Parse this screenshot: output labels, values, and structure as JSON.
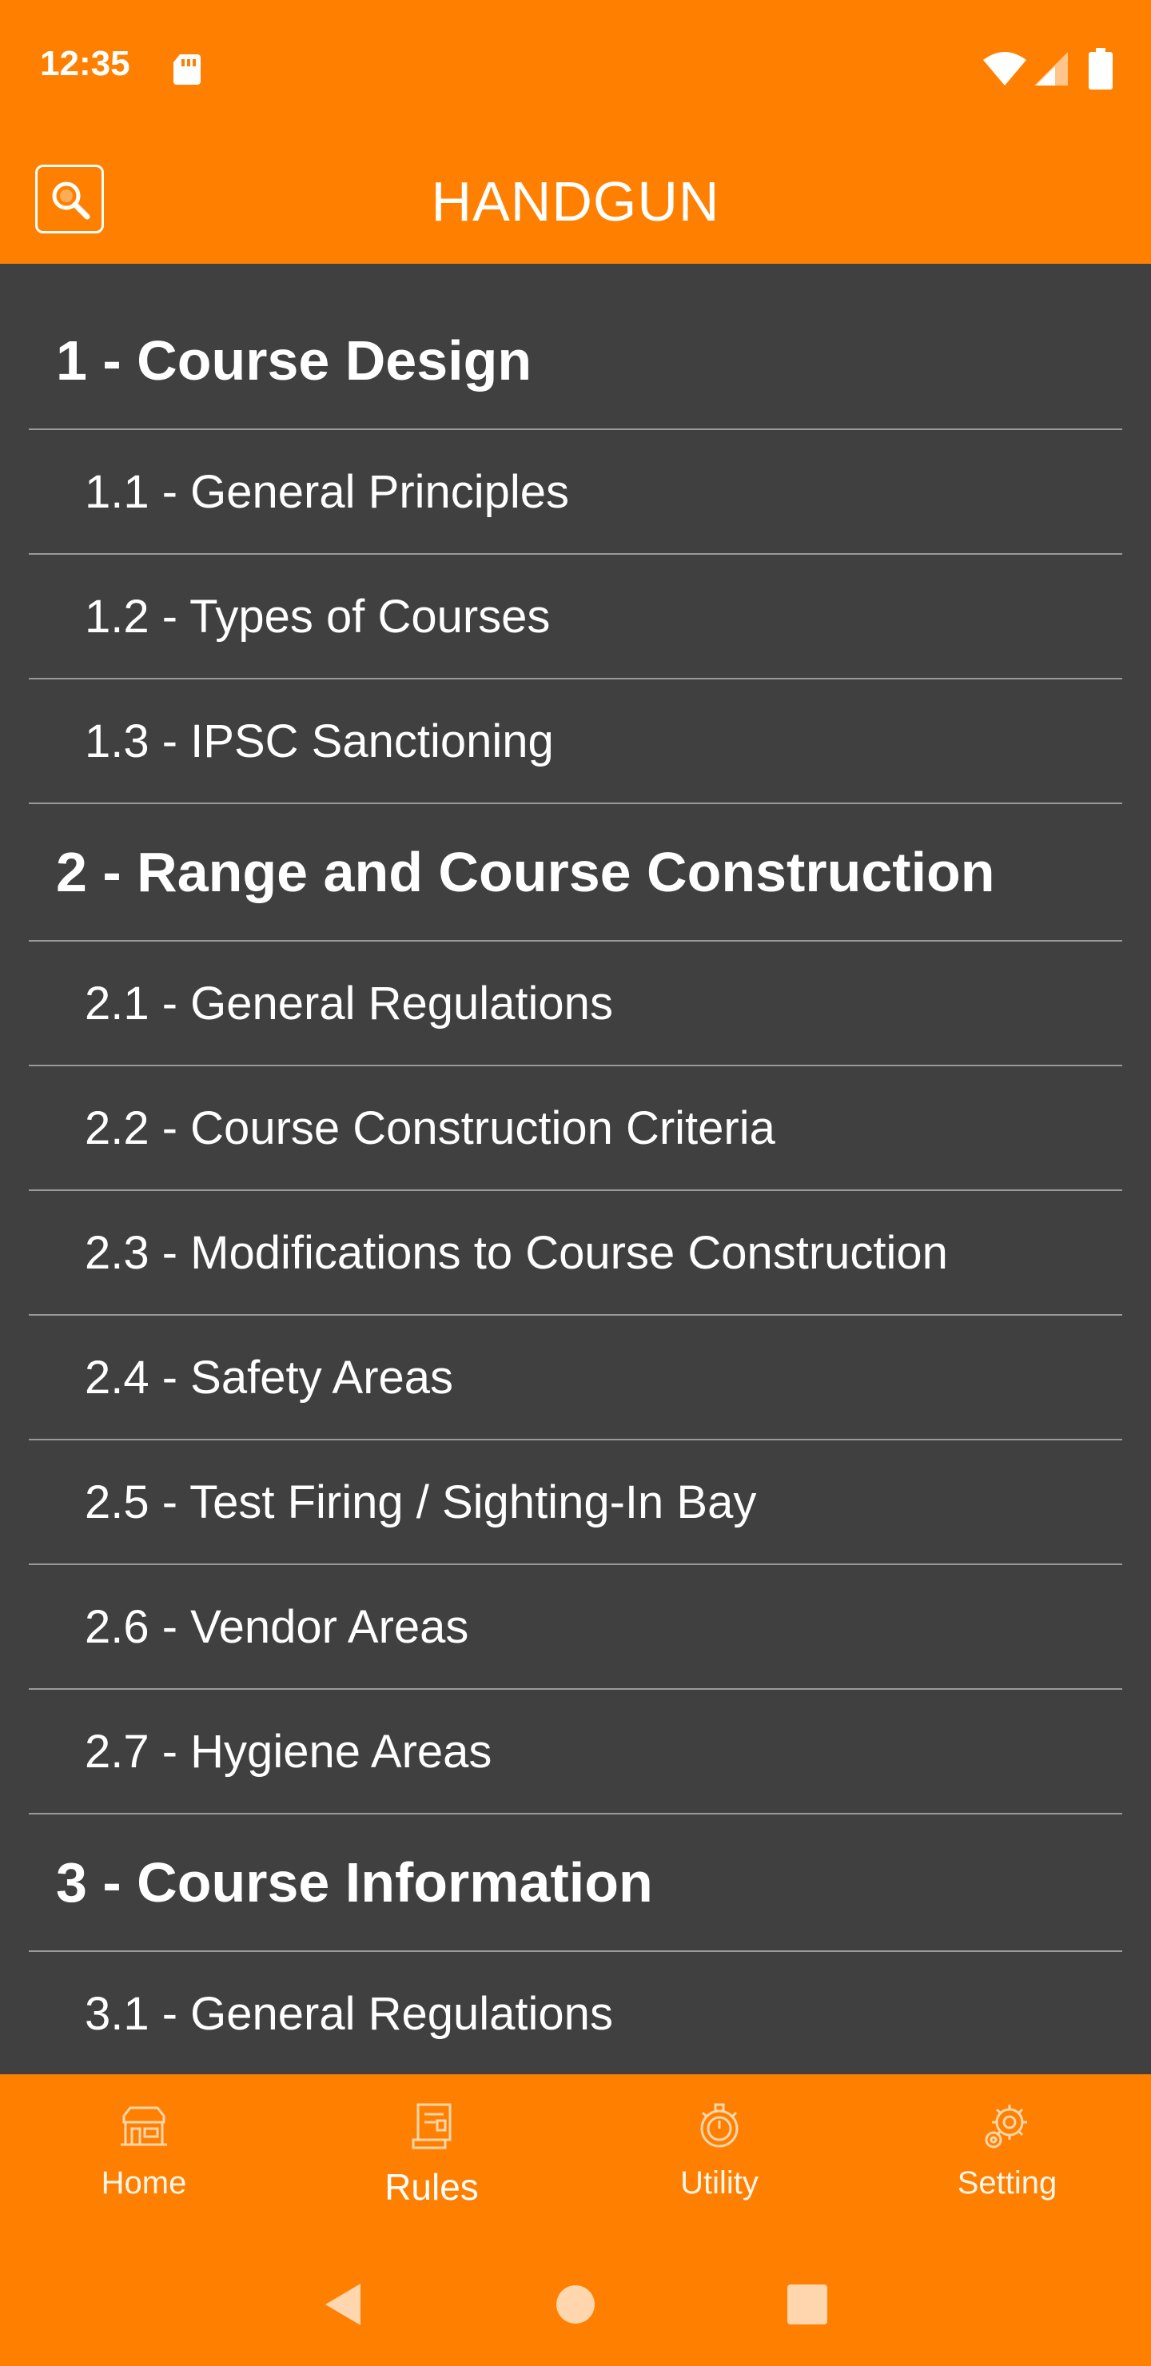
{
  "status_bar": {
    "time": "12:35",
    "icons": [
      "sd-card-icon",
      "wifi-icon",
      "signal-icon",
      "battery-icon"
    ]
  },
  "app_bar": {
    "title": "HANDGUN",
    "search_icon": "search-icon"
  },
  "toc": {
    "chapters": [
      {
        "label": "1 - Course Design"
      },
      {
        "label": "2 - Range and Course Construction"
      },
      {
        "label": "3 - Course Information"
      }
    ],
    "sections": {
      "ch1": [
        "1.1 - General Principles",
        "1.2 - Types of Courses",
        "1.3 - IPSC Sanctioning"
      ],
      "ch2": [
        "2.1 - General Regulations",
        "2.2 - Course Construction Criteria",
        "2.3 - Modifications to Course Construction",
        "2.4 - Safety Areas",
        "2.5 - Test Firing / Sighting-In Bay",
        "2.6 - Vendor Areas",
        "2.7 - Hygiene Areas"
      ],
      "ch3": [
        "3.1 - General Regulations"
      ]
    }
  },
  "bottom_nav": {
    "tabs": [
      {
        "label": "Home",
        "icon": "home-icon"
      },
      {
        "label": "Rules",
        "icon": "rules-icon",
        "active": true
      },
      {
        "label": "Utility",
        "icon": "stopwatch-icon"
      },
      {
        "label": "Setting",
        "icon": "gear-icon"
      }
    ]
  },
  "colors": {
    "accent": "#FF8000",
    "background": "#404040",
    "divider": "#9a9a9a",
    "text": "#FFFFFF"
  }
}
